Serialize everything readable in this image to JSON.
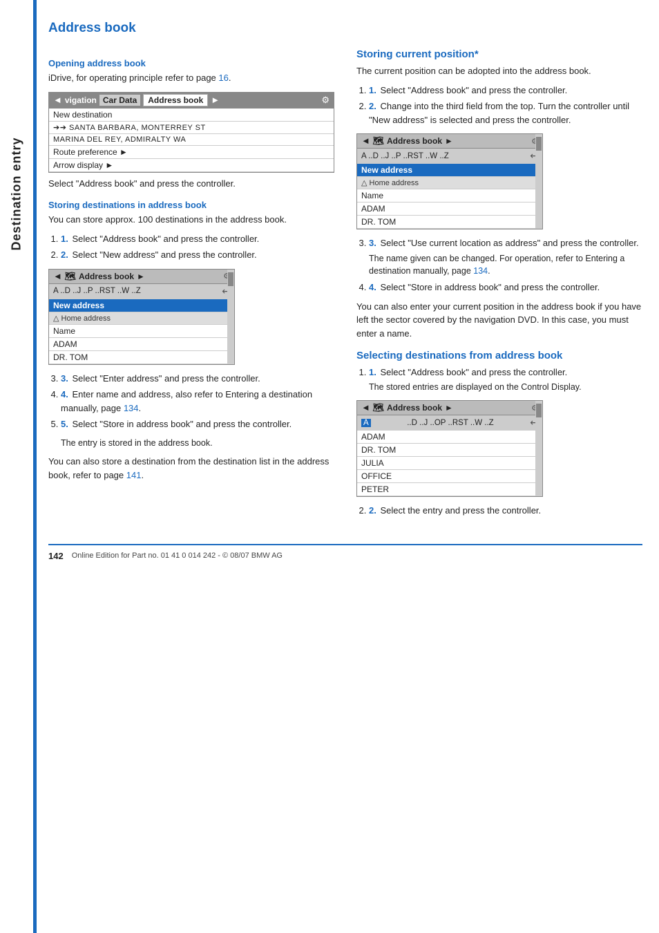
{
  "page": {
    "sidebar_label": "Destination entry",
    "page_title": "Address book",
    "page_number": "142",
    "footer_text": "Online Edition for Part no. 01 41 0 014 242 - © 08/07 BMW AG"
  },
  "left_col": {
    "opening_title": "Opening address book",
    "opening_body": "iDrive, for operating principle refer to page 16.",
    "nav_tabs": [
      "◄",
      "vigation",
      "Car Data",
      "Address book",
      "►"
    ],
    "nav_list": [
      "New destination",
      "➔➔ SANTA BARBARA, MONTERREY ST",
      "MARINA DEL REY, ADMIRALTY WA",
      "Route preference ►",
      "Arrow display ►"
    ],
    "opening_note": "Select \"Address book\" and press the controller.",
    "storing_title": "Storing destinations in address book",
    "storing_body": "You can store approx. 100 destinations in the address book.",
    "storing_steps": [
      "Select \"Address book\" and press the controller.",
      "Select \"New address\" and press the controller.",
      "Select \"Enter address\" and press the controller.",
      "Enter name and address, also refer to Entering a destination manually, page 134.",
      "Select \"Store in address book\" and press the controller."
    ],
    "storing_step4_suffix": "134",
    "entry_stored": "The entry is stored in the address book.",
    "storing_also": "You can also store a destination from the destination list in the address book, refer to page 141.",
    "storing_also_ref": "141",
    "widget1": {
      "header": "Address book",
      "alpha_row": "A ..D ..J ..P ..RST ..W ..Z",
      "entries": [
        {
          "label": "New address",
          "selected": true
        },
        {
          "label": "△ Home address",
          "type": "home"
        },
        {
          "label": "Name",
          "type": "normal"
        },
        {
          "label": "ADAM",
          "type": "normal"
        },
        {
          "label": "DR. TOM",
          "type": "normal"
        }
      ]
    }
  },
  "right_col": {
    "storing_current_title": "Storing current position*",
    "storing_current_body": "The current position can be adopted into the address book.",
    "storing_current_steps": [
      "Select \"Address book\" and press the controller.",
      "Change into the third field from the top. Turn the controller until \"New address\" is selected and press the controller.",
      "Select \"Use current location as address\" and press the controller.",
      "Select \"Store in address book\" and press the controller."
    ],
    "step3_note": "The name given can be changed. For operation, refer to Entering a destination manually, page 134.",
    "step3_ref": "134",
    "storing_also": "You can also enter your current position in the address book if you have left the sector covered by the navigation DVD. In this case, you must enter a name.",
    "widget2": {
      "header": "Address book",
      "alpha_row": "A ..D ..J ..P ..RST ..W ..Z",
      "entries": [
        {
          "label": "New address",
          "selected": true
        },
        {
          "label": "△ Home address",
          "type": "home"
        },
        {
          "label": "Name",
          "type": "normal"
        },
        {
          "label": "ADAM",
          "type": "normal"
        },
        {
          "label": "DR. TOM",
          "type": "normal"
        }
      ]
    },
    "selecting_title": "Selecting destinations from address book",
    "selecting_body": "Select \"Address book\" and press the controller.",
    "selecting_note": "The stored entries are displayed on the Control Display.",
    "selecting_steps": [
      "Select \"Address book\" and press the controller.",
      "Select the entry and press the controller."
    ],
    "widget3": {
      "header": "Address book",
      "alpha_row": "A ..D ..J ..OP ..RST ..W ..Z",
      "entries": [
        {
          "label": "ADAM",
          "selected": false
        },
        {
          "label": "DR. TOM",
          "selected": false
        },
        {
          "label": "JULIA",
          "selected": false
        },
        {
          "label": "OFFICE",
          "selected": false
        },
        {
          "label": "PETER",
          "selected": false
        }
      ]
    }
  }
}
